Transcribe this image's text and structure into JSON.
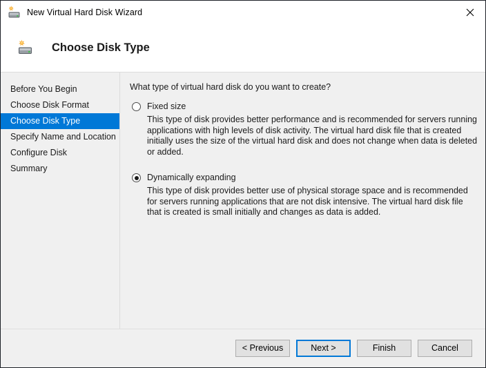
{
  "window": {
    "title": "New Virtual Hard Disk Wizard",
    "title_icon": "new-hard-disk-icon",
    "close_icon": "close-icon",
    "accent_color": "#0078d7",
    "body_background": "#f0f0f0",
    "titlebar_background": "#ffffff"
  },
  "header": {
    "title": "Choose Disk Type",
    "icon": "new-hard-disk-icon"
  },
  "sidebar": {
    "items": [
      {
        "label": "Before You Begin",
        "selected": false
      },
      {
        "label": "Choose Disk Format",
        "selected": false
      },
      {
        "label": "Choose Disk Type",
        "selected": true
      },
      {
        "label": "Specify Name and Location",
        "selected": false
      },
      {
        "label": "Configure Disk",
        "selected": false
      },
      {
        "label": "Summary",
        "selected": false
      }
    ]
  },
  "main": {
    "question": "What type of virtual hard disk do you want to create?",
    "options": [
      {
        "label": "Fixed size",
        "checked": false,
        "description": "This type of disk provides better performance and is recommended for servers running applications with high levels of disk activity. The virtual hard disk file that is created initially uses the size of the virtual hard disk and does not change when data is deleted or added."
      },
      {
        "label": "Dynamically expanding",
        "checked": true,
        "description": "This type of disk provides better use of physical storage space and is recommended for servers running applications that are not disk intensive. The virtual hard disk file that is created is small initially and changes as data is added."
      }
    ]
  },
  "footer": {
    "buttons": [
      {
        "label": "< Previous",
        "focused": false
      },
      {
        "label": "Next >",
        "focused": true
      },
      {
        "label": "Finish",
        "focused": false
      },
      {
        "label": "Cancel",
        "focused": false
      }
    ]
  }
}
